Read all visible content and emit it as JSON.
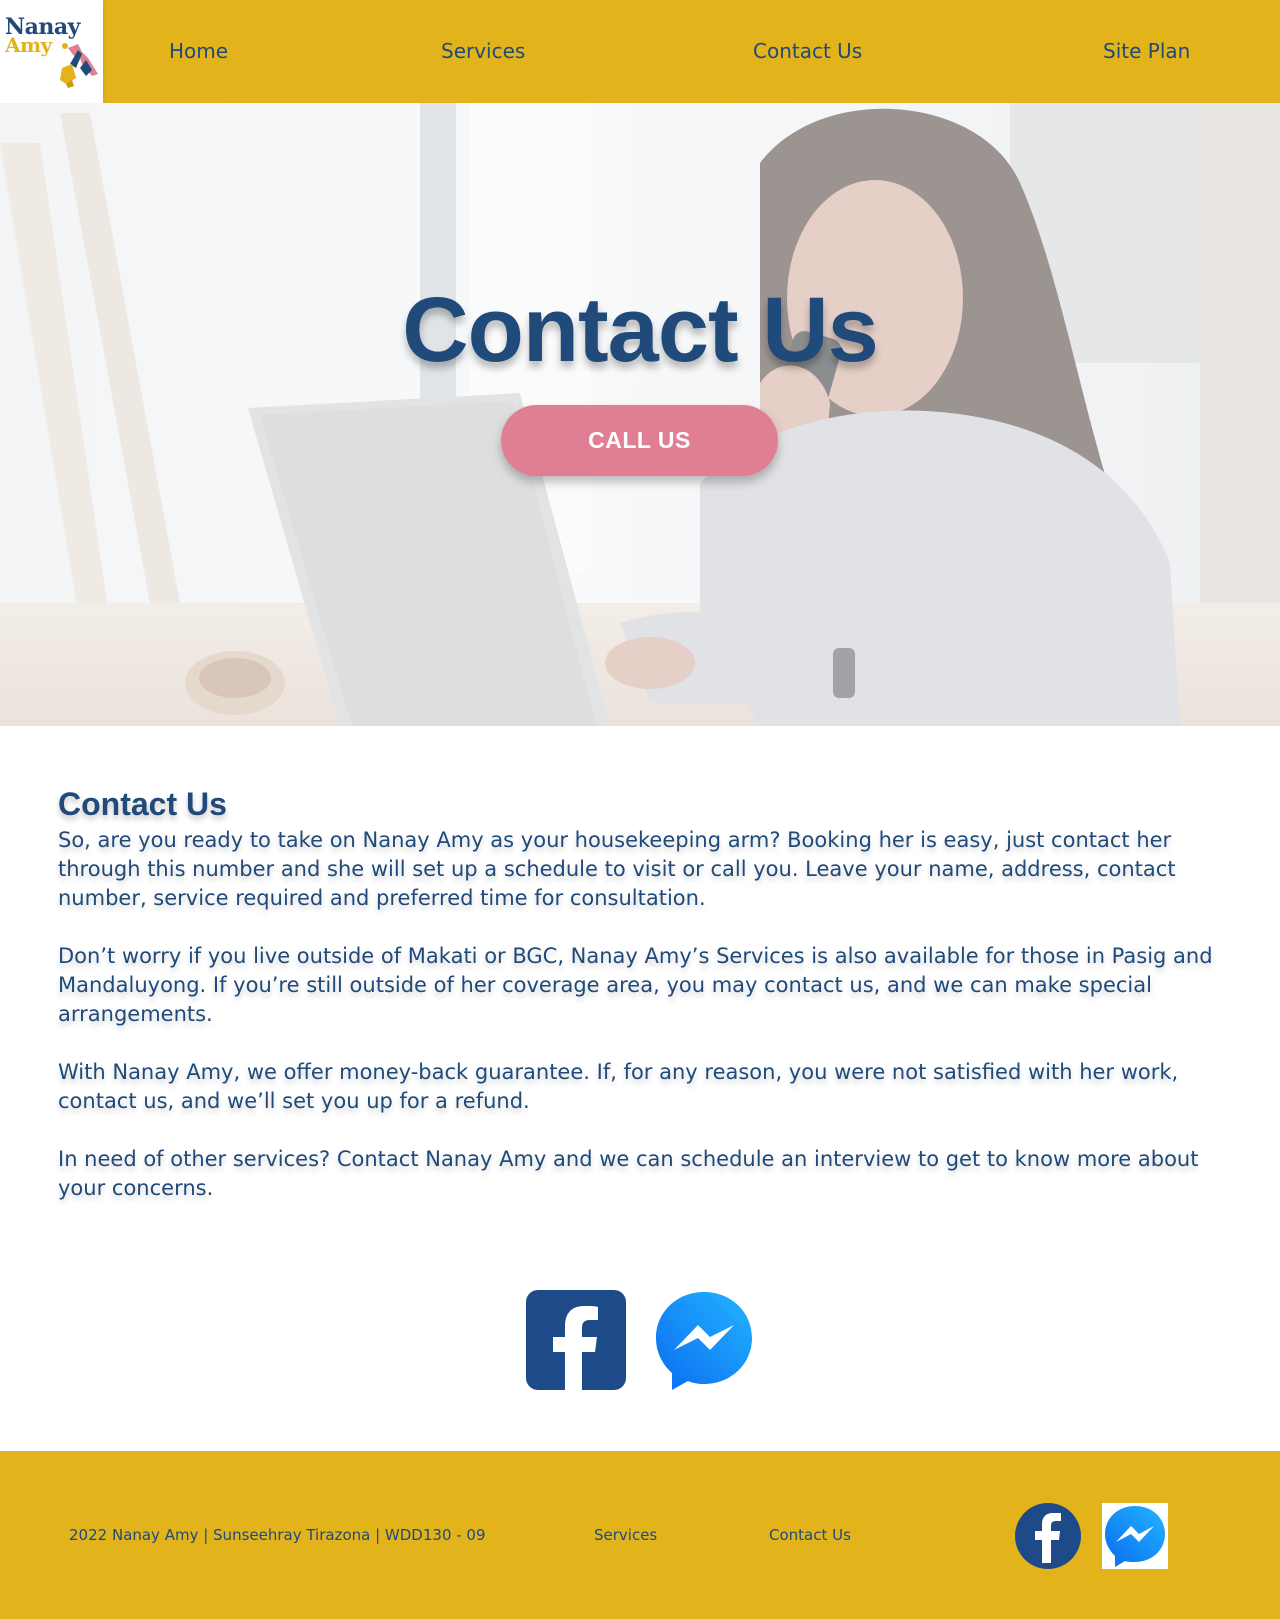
{
  "logo": {
    "line1": "Nanay",
    "line2": "Amy"
  },
  "nav": {
    "home": "Home",
    "services": "Services",
    "contact": "Contact Us",
    "site_plan": "Site Plan"
  },
  "hero": {
    "title": "Contact Us",
    "cta": "CALL US"
  },
  "content": {
    "heading": "Contact Us",
    "paragraphs": [
      "So, are you ready to take on Nanay Amy as your housekeeping arm? Booking her is easy, just contact her through this number and she will set up a schedule to visit or call you. Leave your name, address, contact number, service required and preferred time for consultation.",
      "Don’t worry if you live outside of Makati or BGC, Nanay Amy’s Services is also available for those in Pasig and Mandaluyong. If you’re still outside of her coverage area, you may contact us, and we can make special arrangements.",
      "With Nanay Amy, we offer money-back guarantee. If, for any reason, you were not satisfied with her work, contact us, and we’ll set you up for a refund.",
      "In need of other services? Contact Nanay Amy and we can schedule an interview to get to know more about your concerns."
    ]
  },
  "social": {
    "facebook_icon": "facebook-icon",
    "messenger_icon": "messenger-icon"
  },
  "footer": {
    "copyright": "2022 Nanay Amy | Sunseehray Tirazona | WDD130 - 09",
    "services": "Services",
    "contact": "Contact Us"
  },
  "colors": {
    "header_bg": "#e2b31a",
    "brand_blue": "#1f4a7a",
    "cta_pink": "#e07f93",
    "facebook_blue": "#1f4a8a",
    "messenger_blue": "#1e90ff"
  }
}
